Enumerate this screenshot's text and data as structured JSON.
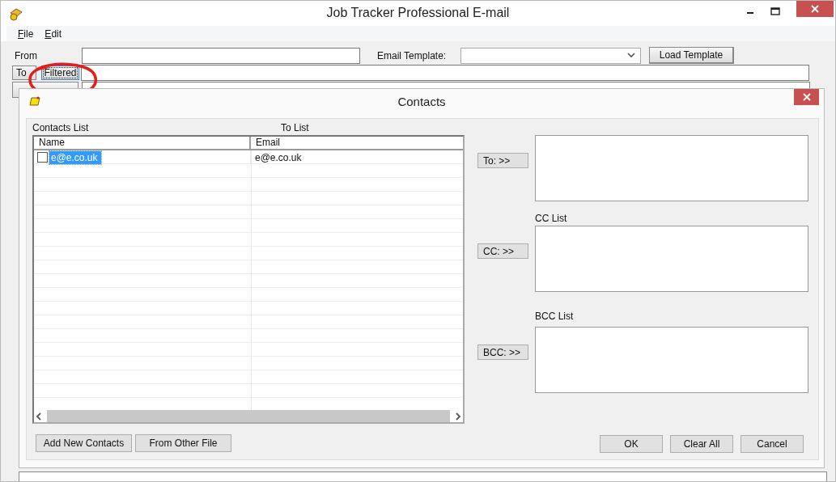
{
  "window": {
    "title": "Job Tracker Professional  E-mail"
  },
  "menu": [
    {
      "label": "File"
    },
    {
      "label": "Edit"
    }
  ],
  "form": {
    "from_label": "From",
    "template_label": "Email Template:",
    "load_button": "Load Template",
    "to_button": "To",
    "filtered_button": "Filtered"
  },
  "dialog": {
    "title": "Contacts",
    "contacts_label": "Contacts List",
    "to_list_label": "To List",
    "columns": [
      "Name",
      "Email"
    ],
    "rows": [
      {
        "name": "e@e.co.uk",
        "email": "e@e.co.uk",
        "checked": false,
        "selected": true
      }
    ],
    "to_button": "To: >>",
    "cc_button": "CC: >>",
    "bcc_button": "BCC: >>",
    "cc_label": "CC List",
    "bcc_label": "BCC List",
    "add_button": "Add New Contacts",
    "other_file_button": "From Other File",
    "ok_button": "OK",
    "clear_button": "Clear All",
    "cancel_button": "Cancel"
  }
}
